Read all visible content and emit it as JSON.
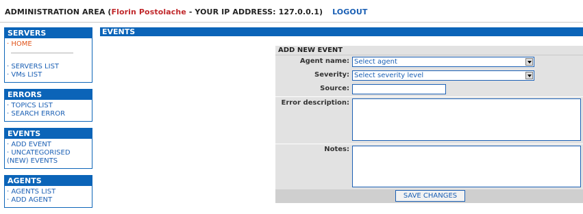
{
  "header": {
    "prefix": "ADMINISTRATION AREA (",
    "user": "Florin Postolache",
    "ip_text": " - YOUR IP ADDRESS: 127.0.0.1)",
    "logout": "LOGOUT"
  },
  "sidebar": {
    "servers": {
      "title": "SERVERS",
      "home": "HOME",
      "items": [
        "SERVERS LIST",
        "VMs LIST"
      ]
    },
    "errors": {
      "title": "ERRORS",
      "items": [
        "TOPICS LIST",
        "SEARCH ERROR"
      ]
    },
    "events": {
      "title": "EVENTS",
      "items": [
        "ADD EVENT",
        "UNCATEGORISED",
        "(NEW) EVENTS"
      ]
    },
    "agents": {
      "title": "AGENTS",
      "items": [
        "AGENTS LIST",
        "ADD AGENT"
      ]
    }
  },
  "main": {
    "title": "EVENTS"
  },
  "form": {
    "heading": "ADD NEW EVENT",
    "agent_label": "Agent name:",
    "agent_value": "Select agent",
    "severity_label": "Severity:",
    "severity_value": "Select severity level",
    "source_label": "Source:",
    "source_value": "",
    "description_label": "Error description:",
    "description_value": "",
    "notes_label": "Notes:",
    "notes_value": "",
    "save": "SAVE CHANGES"
  },
  "colors": {
    "accent": "#0b64b8",
    "link": "#1a5fb4",
    "user_name": "#c0282b",
    "home_link": "#e0541a",
    "form_bg": "#e2e2e2"
  }
}
